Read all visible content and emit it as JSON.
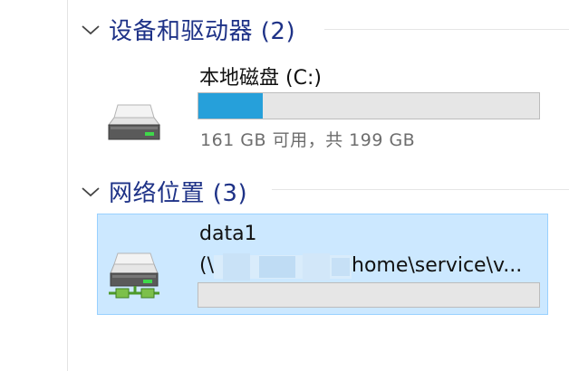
{
  "groups": [
    {
      "title": "设备和驱动器 (2)",
      "drives": [
        {
          "name": "本地磁盘 (C:)",
          "info": "161 GB 可用，共 199 GB",
          "used_fraction": 0.19,
          "icon": "hard-drive-icon"
        }
      ]
    },
    {
      "title": "网络位置 (3)",
      "drives": [
        {
          "name": "data1",
          "path_prefix": "(\\",
          "path_suffix": "home\\service\\v...",
          "icon": "network-drive-icon",
          "selected": true
        }
      ]
    }
  ],
  "colors": {
    "selection_bg": "#cce8ff",
    "selection_border": "#99d1ff",
    "bar_fill": "#26a0da",
    "header_text": "#1e3287"
  }
}
